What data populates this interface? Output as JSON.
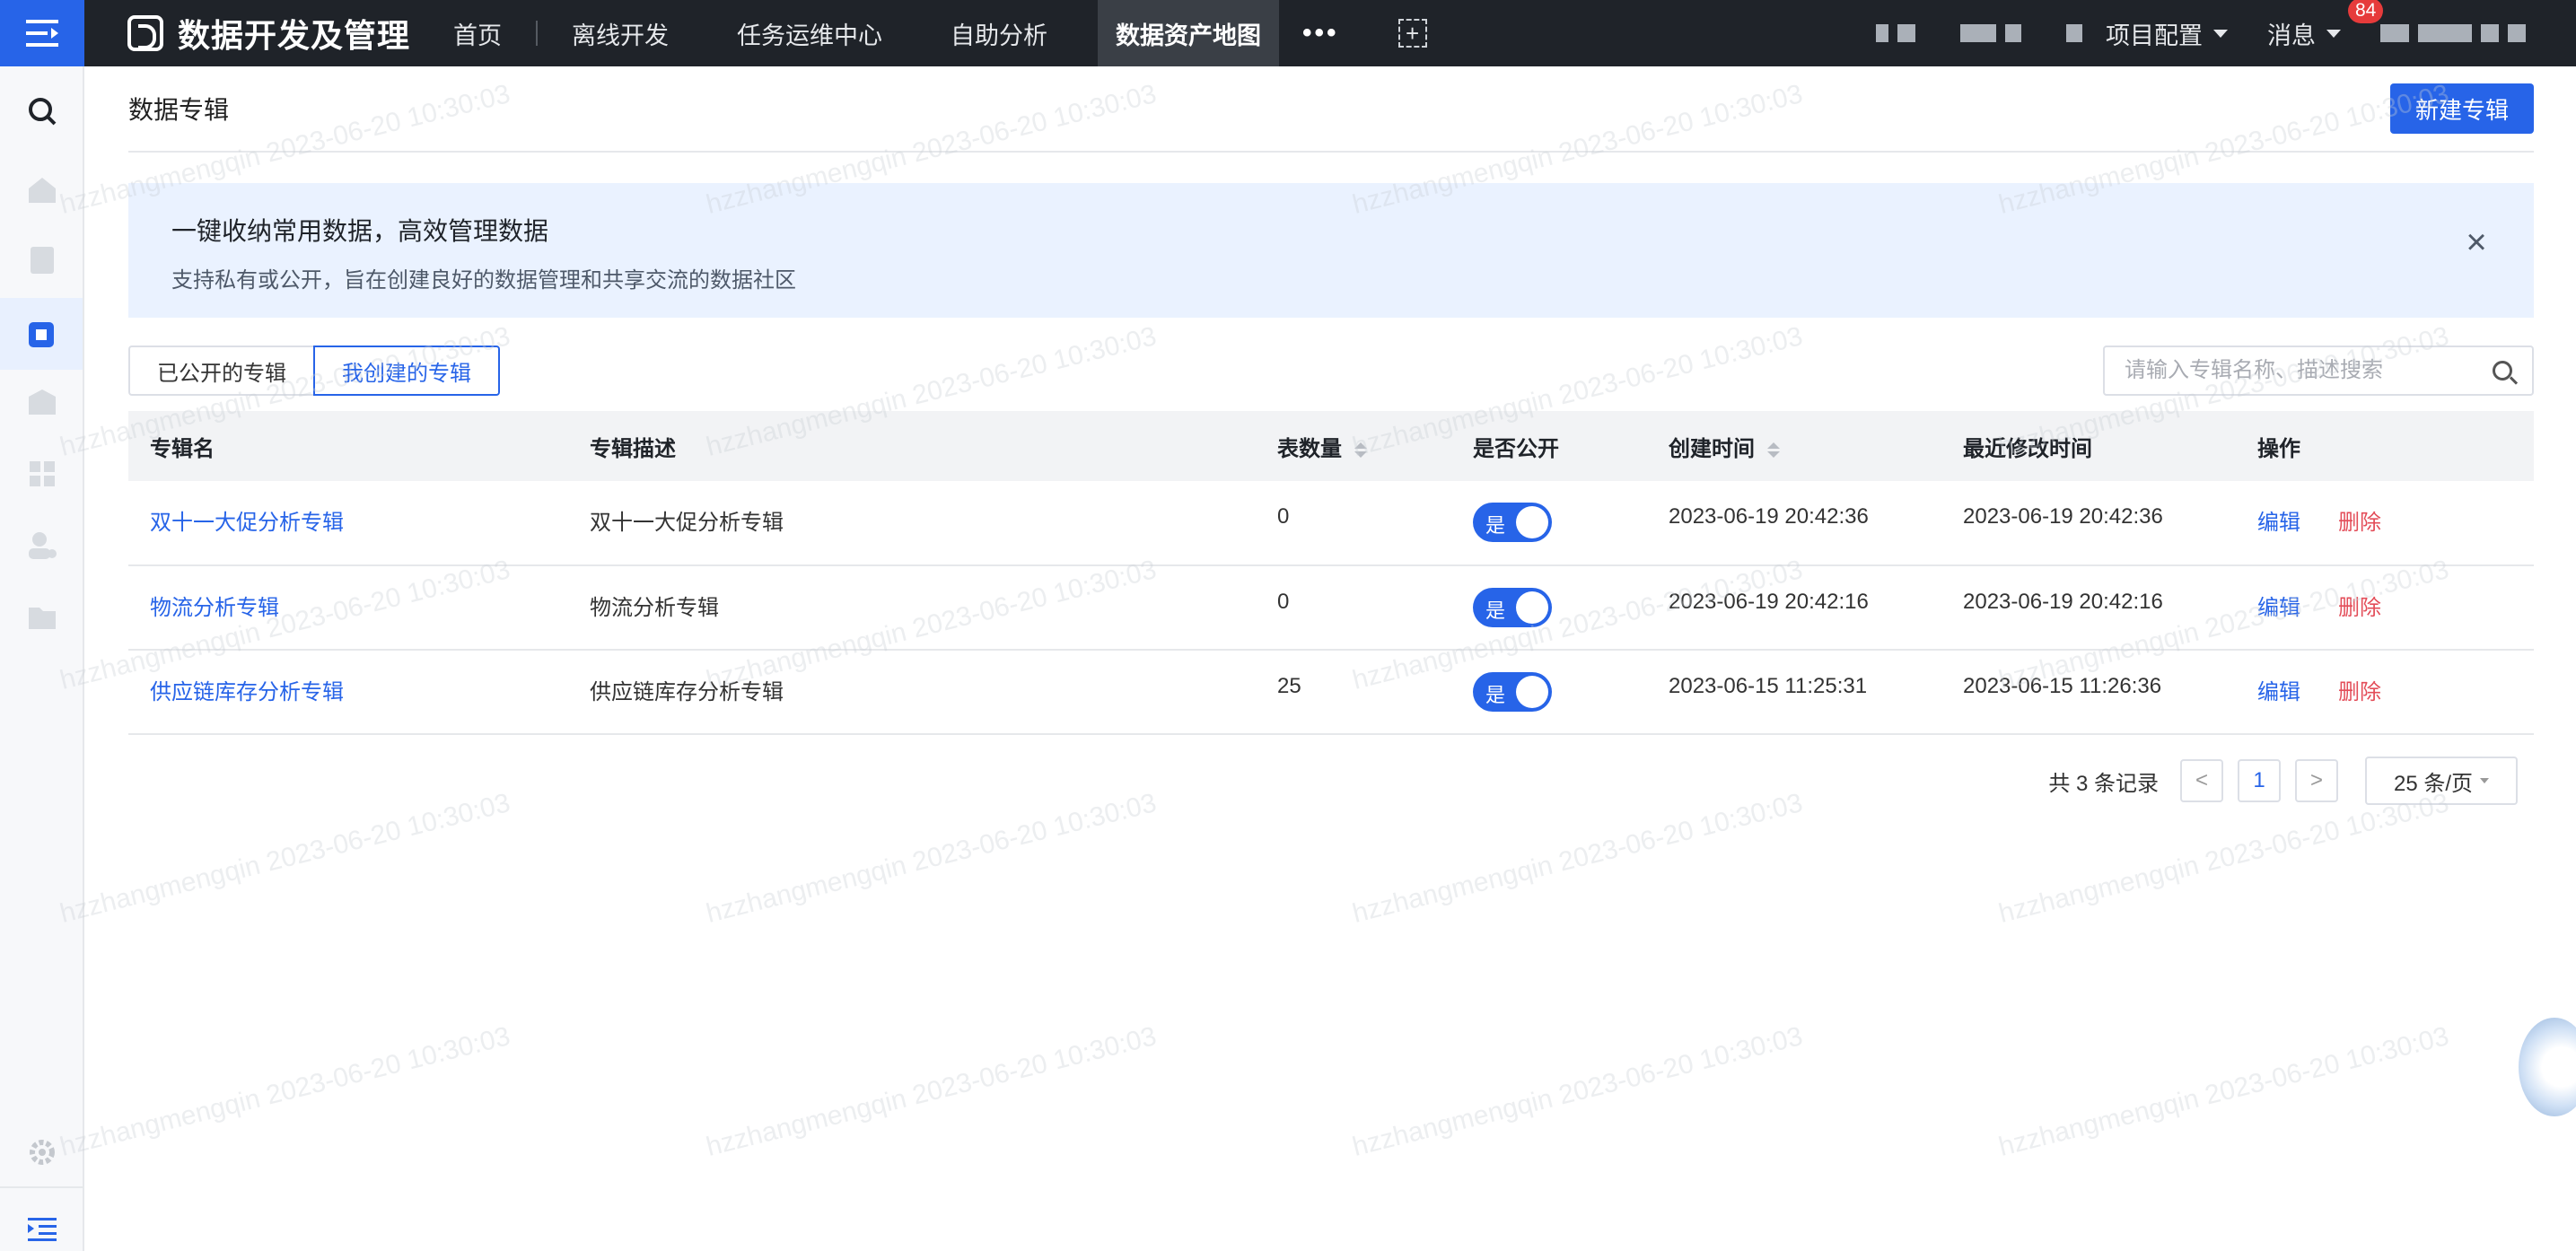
{
  "topbar": {
    "app_title": "数据开发及管理",
    "nav": [
      "首页",
      "离线开发",
      "任务运维中心",
      "自助分析",
      "数据资产地图"
    ],
    "more": "•••",
    "add": "+",
    "project_config": "项目配置",
    "messages": "消息",
    "message_count": "84"
  },
  "page": {
    "title": "数据专辑",
    "new_button": "新建专辑"
  },
  "banner": {
    "title": "一键收纳常用数据，高效管理数据",
    "desc": "支持私有或公开，旨在创建良好的数据管理和共享交流的数据社区",
    "close": "×"
  },
  "tabs": [
    "已公开的专辑",
    "我创建的专辑"
  ],
  "search": {
    "placeholder": "请输入专辑名称、描述搜索"
  },
  "table": {
    "headers": [
      "专辑名",
      "专辑描述",
      "表数量",
      "是否公开",
      "创建时间",
      "最近修改时间",
      "操作"
    ],
    "rows": [
      {
        "name": "双十一大促分析专辑",
        "desc": "双十一大促分析专辑",
        "count": "0",
        "public": "是",
        "created": "2023-06-19 20:42:36",
        "modified": "2023-06-19 20:42:36",
        "edit": "编辑",
        "delete": "删除"
      },
      {
        "name": "物流分析专辑",
        "desc": "物流分析专辑",
        "count": "0",
        "public": "是",
        "created": "2023-06-19 20:42:16",
        "modified": "2023-06-19 20:42:16",
        "edit": "编辑",
        "delete": "删除"
      },
      {
        "name": "供应链库存分析专辑",
        "desc": "供应链库存分析专辑",
        "count": "25",
        "public": "是",
        "created": "2023-06-15 11:25:31",
        "modified": "2023-06-15 11:26:36",
        "edit": "编辑",
        "delete": "删除"
      }
    ]
  },
  "pager": {
    "total": "共 3 条记录",
    "prev": "<",
    "current": "1",
    "next": ">",
    "page_size": "25 条/页"
  },
  "watermark": "hzzhangmengqin 2023-06-20 10:30:03",
  "colors": {
    "primary": "#2764e8",
    "danger": "#e34d59",
    "topbar": "#1f2329"
  }
}
